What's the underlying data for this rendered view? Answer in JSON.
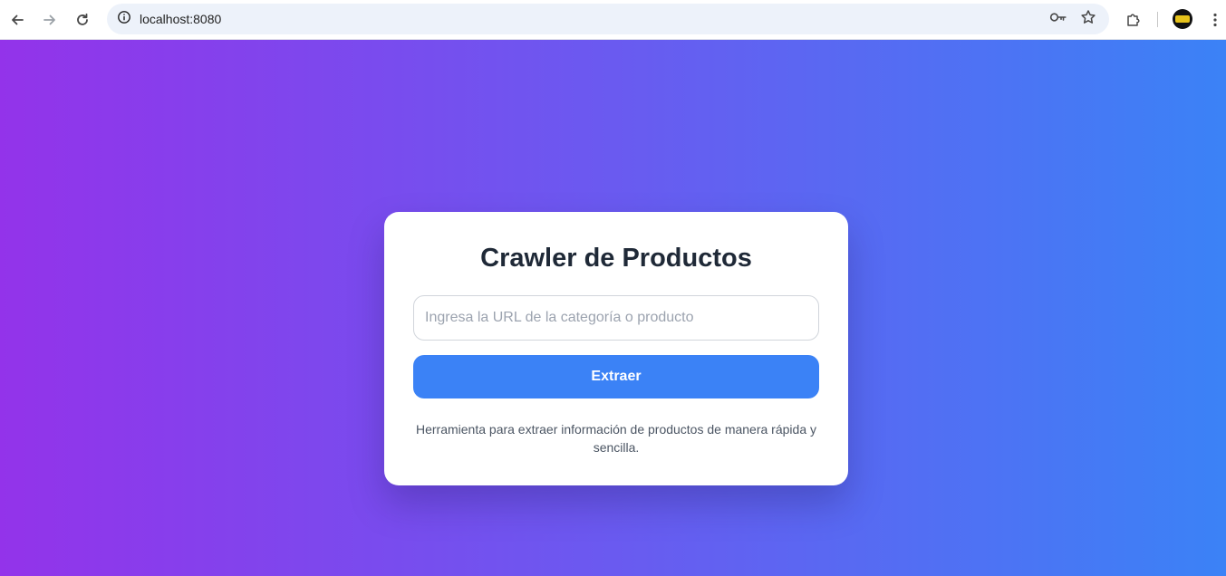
{
  "browser": {
    "url": "localhost:8080",
    "icons": {
      "back": "arrow-left-icon",
      "forward": "arrow-right-icon",
      "reload": "reload-icon",
      "site_info": "info-icon",
      "password": "key-icon",
      "bookmark": "star-icon",
      "extensions": "puzzle-icon",
      "menu": "kebab-menu-icon"
    }
  },
  "page": {
    "background_gradient": [
      "#9333ea",
      "#3b82f6"
    ]
  },
  "card": {
    "title": "Crawler de Productos",
    "input_placeholder": "Ingresa la URL de la categoría o producto",
    "input_value": "",
    "button_label": "Extraer",
    "button_color": "#3b82f6",
    "description": "Herramienta para extraer información de productos de manera rápida y sencilla."
  }
}
